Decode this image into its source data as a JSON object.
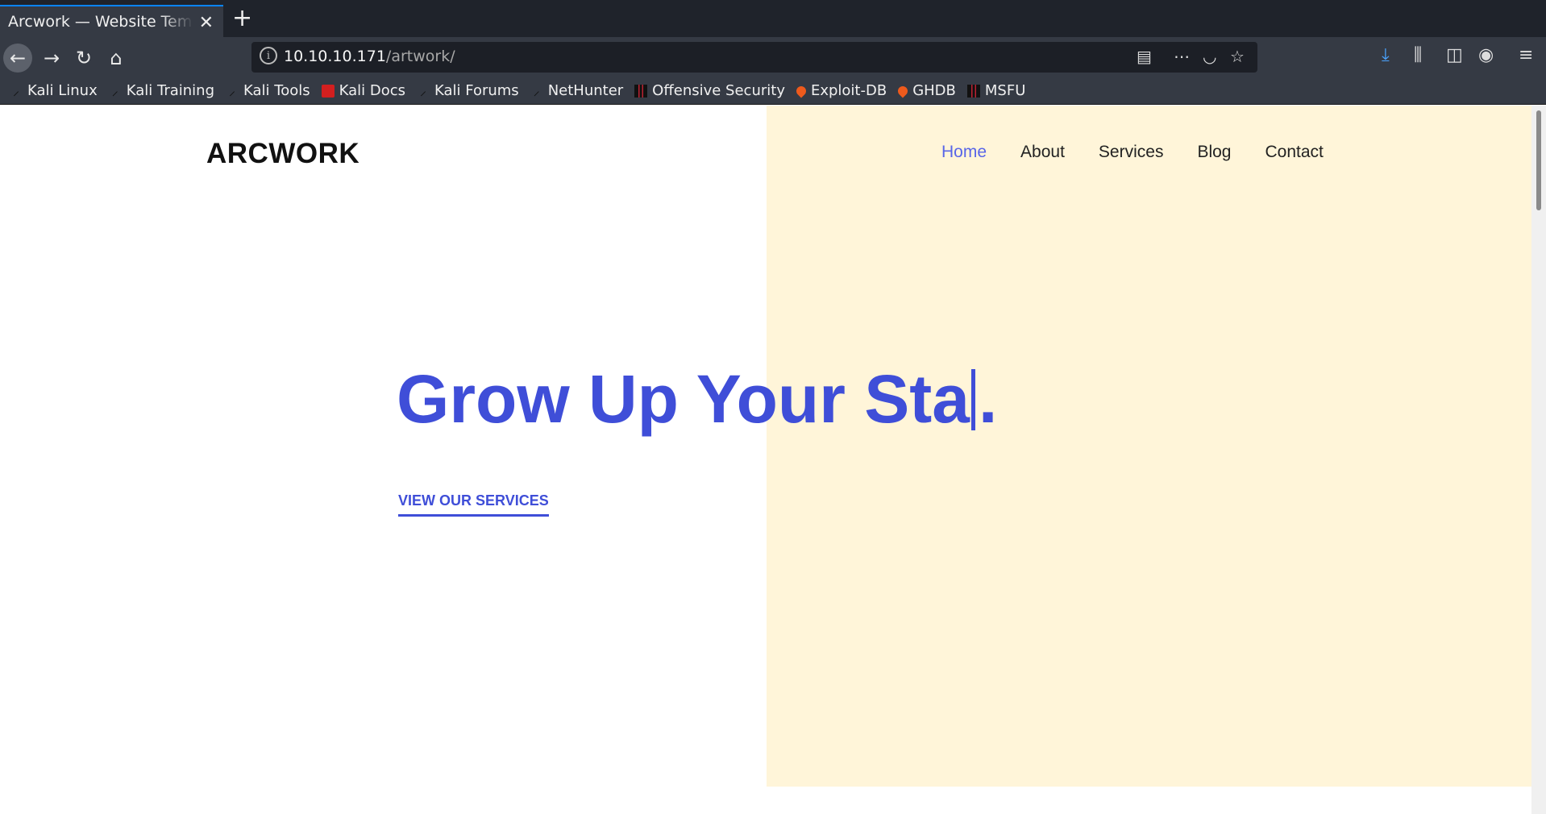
{
  "browser": {
    "tab_title": "Arcwork — Website Template",
    "new_tab_symbol": "+",
    "url_host": "10.10.10.171",
    "url_path": "/artwork/",
    "bookmarks": [
      {
        "label": "Kali Linux",
        "icon": "kali-icon"
      },
      {
        "label": "Kali Training",
        "icon": "kali-icon"
      },
      {
        "label": "Kali Tools",
        "icon": "kali-icon"
      },
      {
        "label": "Kali Docs",
        "icon": "kali-docs-icon"
      },
      {
        "label": "Kali Forums",
        "icon": "kali-icon"
      },
      {
        "label": "NetHunter",
        "icon": "kali-icon"
      },
      {
        "label": "Offensive Security",
        "icon": "offsec-icon"
      },
      {
        "label": "Exploit-DB",
        "icon": "exploitdb-icon"
      },
      {
        "label": "GHDB",
        "icon": "exploitdb-icon"
      },
      {
        "label": "MSFU",
        "icon": "offsec-icon"
      }
    ]
  },
  "site": {
    "logo": "ARCWORK",
    "menu": [
      "Home",
      "About",
      "Services",
      "Blog",
      "Contact"
    ],
    "active_menu": "Home",
    "headline_before_cursor": "Grow Up Your Sta",
    "headline_after_cursor": ".",
    "cta": "VIEW OUR SERVICES"
  },
  "colors": {
    "accent": "#3f4ed8",
    "hero_bg": "#fff5d9",
    "chrome": "#353a44"
  }
}
